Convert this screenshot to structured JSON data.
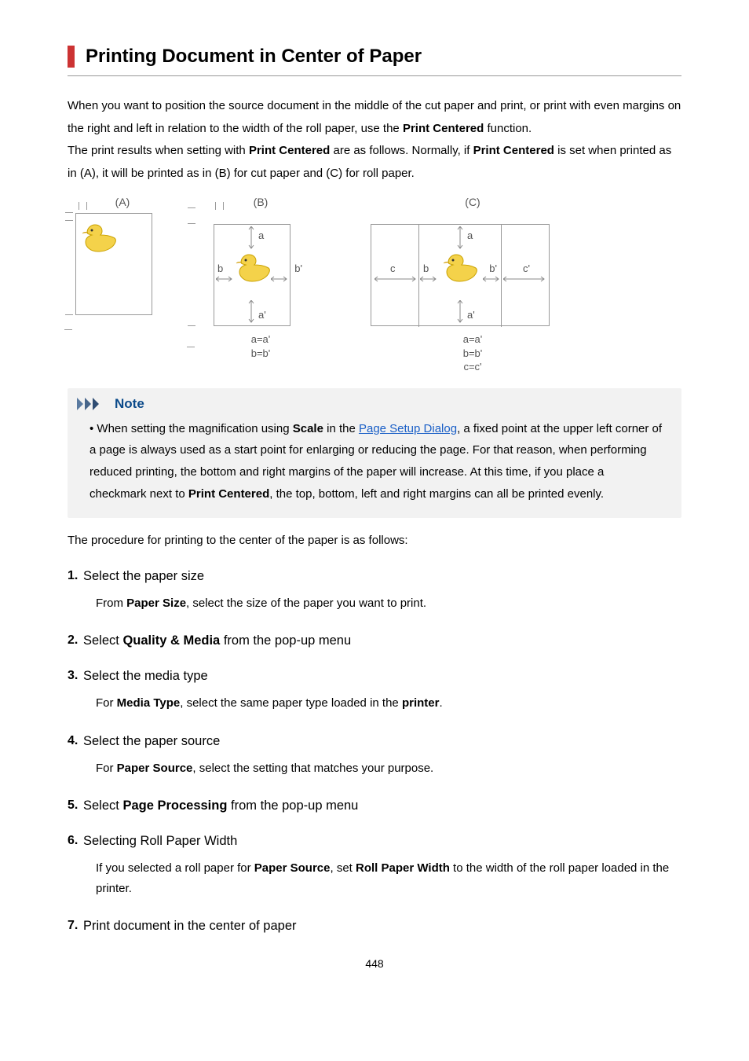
{
  "title": "Printing Document in Center of Paper",
  "intro": {
    "pre1": "When you want to position the source document in the middle of the cut paper and print, or print with even margins on the right and left in relation to the width of the roll paper, use the ",
    "b1": "Print Centered",
    "post1": " function.",
    "pre2": "The print results when setting with ",
    "b2": "Print Centered",
    "mid2": " are as follows. Normally, if ",
    "b3": "Print Centered",
    "post2": " is set when printed as in (A), it will be printed as in (B) for cut paper and (C) for roll paper."
  },
  "diagram": {
    "A": "(A)",
    "B": "(B)",
    "C": "(C)",
    "a": "a",
    "ap": "a'",
    "b": "b",
    "bp": "b'",
    "c": "c",
    "cp": "c'",
    "eqB1": "a=a'",
    "eqB2": "b=b'",
    "eqC1": "a=a'",
    "eqC2": "b=b'",
    "eqC3": "c=c'"
  },
  "note": {
    "heading": "Note",
    "bullet_pre": "When setting the magnification using ",
    "bullet_b1": "Scale",
    "bullet_mid": " in the ",
    "link_text": "Page Setup Dialog",
    "bullet_post": ", a fixed point at the upper left corner of a page is always used as a start point for enlarging or reducing the page. For that reason, when performing reduced printing, the bottom and right margins of the paper will increase. At this time, if you place a checkmark next to ",
    "bullet_b2": "Print Centered",
    "bullet_tail": ", the top, bottom, left and right margins can all be printed evenly."
  },
  "proc_intro": "The procedure for printing to the center of the paper is as follows:",
  "steps": [
    {
      "head": "Select the paper size",
      "body_pre": "From ",
      "body_b": "Paper Size",
      "body_post": ", select the size of the paper you want to print."
    },
    {
      "head_pre": "Select ",
      "head_b": "Quality & Media",
      "head_post": " from the pop-up menu"
    },
    {
      "head": "Select the media type",
      "body_pre": "For ",
      "body_b": "Media Type",
      "body_mid": ", select the same paper type loaded in the ",
      "body_b2": "printer",
      "body_post": "."
    },
    {
      "head": "Select the paper source",
      "body_pre": "For ",
      "body_b": "Paper Source",
      "body_post": ", select the setting that matches your purpose."
    },
    {
      "head_pre": "Select ",
      "head_b": "Page Processing",
      "head_post": " from the pop-up menu"
    },
    {
      "head": "Selecting Roll Paper Width",
      "body_pre": "If you selected a roll paper for ",
      "body_b": "Paper Source",
      "body_mid": ", set ",
      "body_b2": "Roll Paper Width",
      "body_post": " to the width of the roll paper loaded in the printer."
    },
    {
      "head": "Print document in the center of paper"
    }
  ],
  "page_number": "448"
}
